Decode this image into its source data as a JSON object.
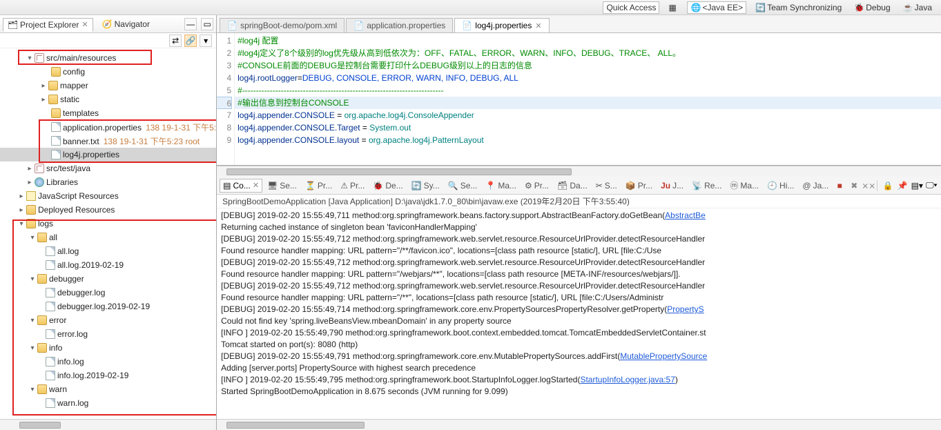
{
  "top": {
    "quick_access": "Quick Access",
    "perspective_javaee": "<Java EE>",
    "team_sync": "Team Synchronizing",
    "debug": "Debug",
    "java": "Java"
  },
  "left": {
    "tabs": {
      "project_explorer": "Project Explorer",
      "navigator": "Navigator"
    },
    "tree": {
      "src_main_resources": "src/main/resources",
      "config": "config",
      "mapper": "mapper",
      "static": "static",
      "templates": "templates",
      "app_props": "application.properties",
      "app_props_meta": "138  19-1-31 下午5:",
      "banner": "banner.txt",
      "banner_meta": "138  19-1-31 下午5:23  root",
      "log4j_props": "log4j.properties",
      "src_test_java": "src/test/java",
      "libraries": "Libraries",
      "js_resources": "JavaScript Resources",
      "deployed": "Deployed Resources",
      "logs": "logs",
      "all": "all",
      "all_log": "all.log",
      "all_log_date": "all.log.2019-02-19",
      "debugger": "debugger",
      "debugger_log": "debugger.log",
      "debugger_log_date": "debugger.log.2019-02-19",
      "error": "error",
      "error_log": "error.log",
      "info": "info",
      "info_log": "info.log",
      "info_log_date": "info.log.2019-02-19",
      "warn": "warn",
      "warn_log": "warn.log"
    }
  },
  "editor": {
    "tabs": {
      "pom": "springBoot-demo/pom.xml",
      "app_props": "application.properties",
      "log4j_props": "log4j.properties"
    },
    "lines": {
      "l1": "#log4j 配置",
      "l2": "#log4j定义了8个级别的log优先级从高到低依次为：OFF、FATAL、ERROR、WARN、INFO、DEBUG、TRACE、 ALL。",
      "l3": "#CONSOLE前面的DEBUG是控制台需要打印什么DEBUG级别以上的日志的信息",
      "l4_key": "log4j.rootLogger",
      "l4_eq": "=",
      "l4_val": "DEBUG, CONSOLE, ERROR, WARN, INFO, DEBUG, ALL",
      "l5": "#-------------------------------------------------------------------------",
      "l6": "#输出信息到控制台CONSOLE",
      "l7_key": "log4j.appender.CONSOLE",
      "eq": " = ",
      "l7_val": "org.apache.log4j.ConsoleAppender",
      "l8_key": "log4j.appender.CONSOLE.Target",
      "l8_val": "System.out",
      "l9_key": "log4j.appender.CONSOLE.layout",
      "l9_val": "org.apache.log4j.PatternLayout"
    },
    "gutter": [
      "1",
      "2",
      "3",
      "4",
      "5",
      "6",
      "7",
      "8",
      "9"
    ]
  },
  "console": {
    "tabs": {
      "co": "Co...",
      "se": "Se...",
      "pr": "Pr...",
      "pr2": "Pr...",
      "de": "De...",
      "sy": "Sy...",
      "se2": "Se...",
      "ma": "Ma...",
      "pr3": "Pr...",
      "da": "Da...",
      "sn": "S...",
      "pr4": "Pr...",
      "ju": "J...",
      "re": "Re...",
      "ma2": "Ma...",
      "hi": "Hi...",
      "ja": "Ja..."
    },
    "head": "SpringBootDemoApplication [Java Application] D:\\java\\jdk1.7.0_80\\bin\\javaw.exe (2019年2月20日 下午3:55:40)",
    "body": {
      "l1a": "[DEBUG] 2019-02-20 15:55:49,711 method:org.springframework.beans.factory.support.AbstractBeanFactory.doGetBean(",
      "l1b": "AbstractBe",
      "l2": "Returning cached instance of singleton bean 'faviconHandlerMapping'",
      "l3": "[DEBUG] 2019-02-20 15:55:49,712 method:org.springframework.web.servlet.resource.ResourceUrlProvider.detectResourceHandler",
      "l4": "Found resource handler mapping: URL pattern=\"/**/favicon.ico\", locations=[class path resource [static/], URL [file:C:/Use",
      "l5": "[DEBUG] 2019-02-20 15:55:49,712 method:org.springframework.web.servlet.resource.ResourceUrlProvider.detectResourceHandler",
      "l6": "Found resource handler mapping: URL pattern=\"/webjars/**\", locations=[class path resource [META-INF/resources/webjars/]].",
      "l7": "[DEBUG] 2019-02-20 15:55:49,712 method:org.springframework.web.servlet.resource.ResourceUrlProvider.detectResourceHandler",
      "l8": "Found resource handler mapping: URL pattern=\"/**\", locations=[class path resource [static/], URL [file:C:/Users/Administr",
      "l9a": "[DEBUG] 2019-02-20 15:55:49,714 method:org.springframework.core.env.PropertySourcesPropertyResolver.getProperty(",
      "l9b": "PropertyS",
      "l10": "Could not find key 'spring.liveBeansView.mbeanDomain' in any property source",
      "l11": "[INFO ] 2019-02-20 15:55:49,790 method:org.springframework.boot.context.embedded.tomcat.TomcatEmbeddedServletContainer.st",
      "l12": "Tomcat started on port(s): 8080 (http)",
      "l13a": "[DEBUG] 2019-02-20 15:55:49,791 method:org.springframework.core.env.MutablePropertySources.addFirst(",
      "l13b": "MutablePropertySource",
      "l14": "Adding [server.ports] PropertySource with highest search precedence",
      "l15a": "[INFO ] 2019-02-20 15:55:49,795 method:org.springframework.boot.StartupInfoLogger.logStarted(",
      "l15b": "StartupInfoLogger.java:57",
      "l15c": ")",
      "l16": "Started SpringBootDemoApplication in 8.675 seconds (JVM running for 9.099)"
    }
  }
}
